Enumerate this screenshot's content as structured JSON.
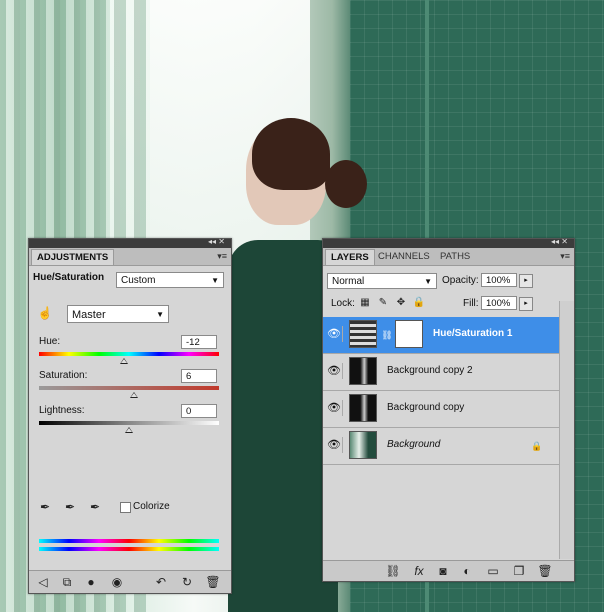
{
  "adjustments": {
    "tab": "ADJUSTMENTS",
    "title": "Hue/Saturation",
    "preset": "Custom",
    "channel": "Master",
    "hue": {
      "label": "Hue:",
      "value": "-12",
      "level": 0.47
    },
    "saturation": {
      "label": "Saturation:",
      "value": "6",
      "level": 0.53
    },
    "lightness": {
      "label": "Lightness:",
      "value": "0",
      "level": 0.5
    },
    "colorize_label": "Colorize",
    "colorize_checked": false,
    "icons": [
      "targeted-adjust-icon",
      "eyedropper-icon",
      "eyedropper-plus-icon",
      "eyedropper-minus-icon",
      "back-arrow-icon",
      "expand-view-icon",
      "clip-layer-icon",
      "visibility-icon",
      "previous-state-icon",
      "reset-icon",
      "trash-icon"
    ]
  },
  "layers": {
    "tabs": [
      "LAYERS",
      "CHANNELS",
      "PATHS"
    ],
    "blend_mode": "Normal",
    "opacity_label": "Opacity:",
    "opacity": "100%",
    "lock_label": "Lock:",
    "fill_label": "Fill:",
    "fill": "100%",
    "items": [
      {
        "name": "Hue/Saturation 1",
        "selected": true
      },
      {
        "name": "Background copy 2",
        "selected": false
      },
      {
        "name": "Background copy",
        "selected": false
      },
      {
        "name": "Background",
        "selected": false,
        "locked": true
      }
    ],
    "accent_color": "#3e8ee8"
  }
}
